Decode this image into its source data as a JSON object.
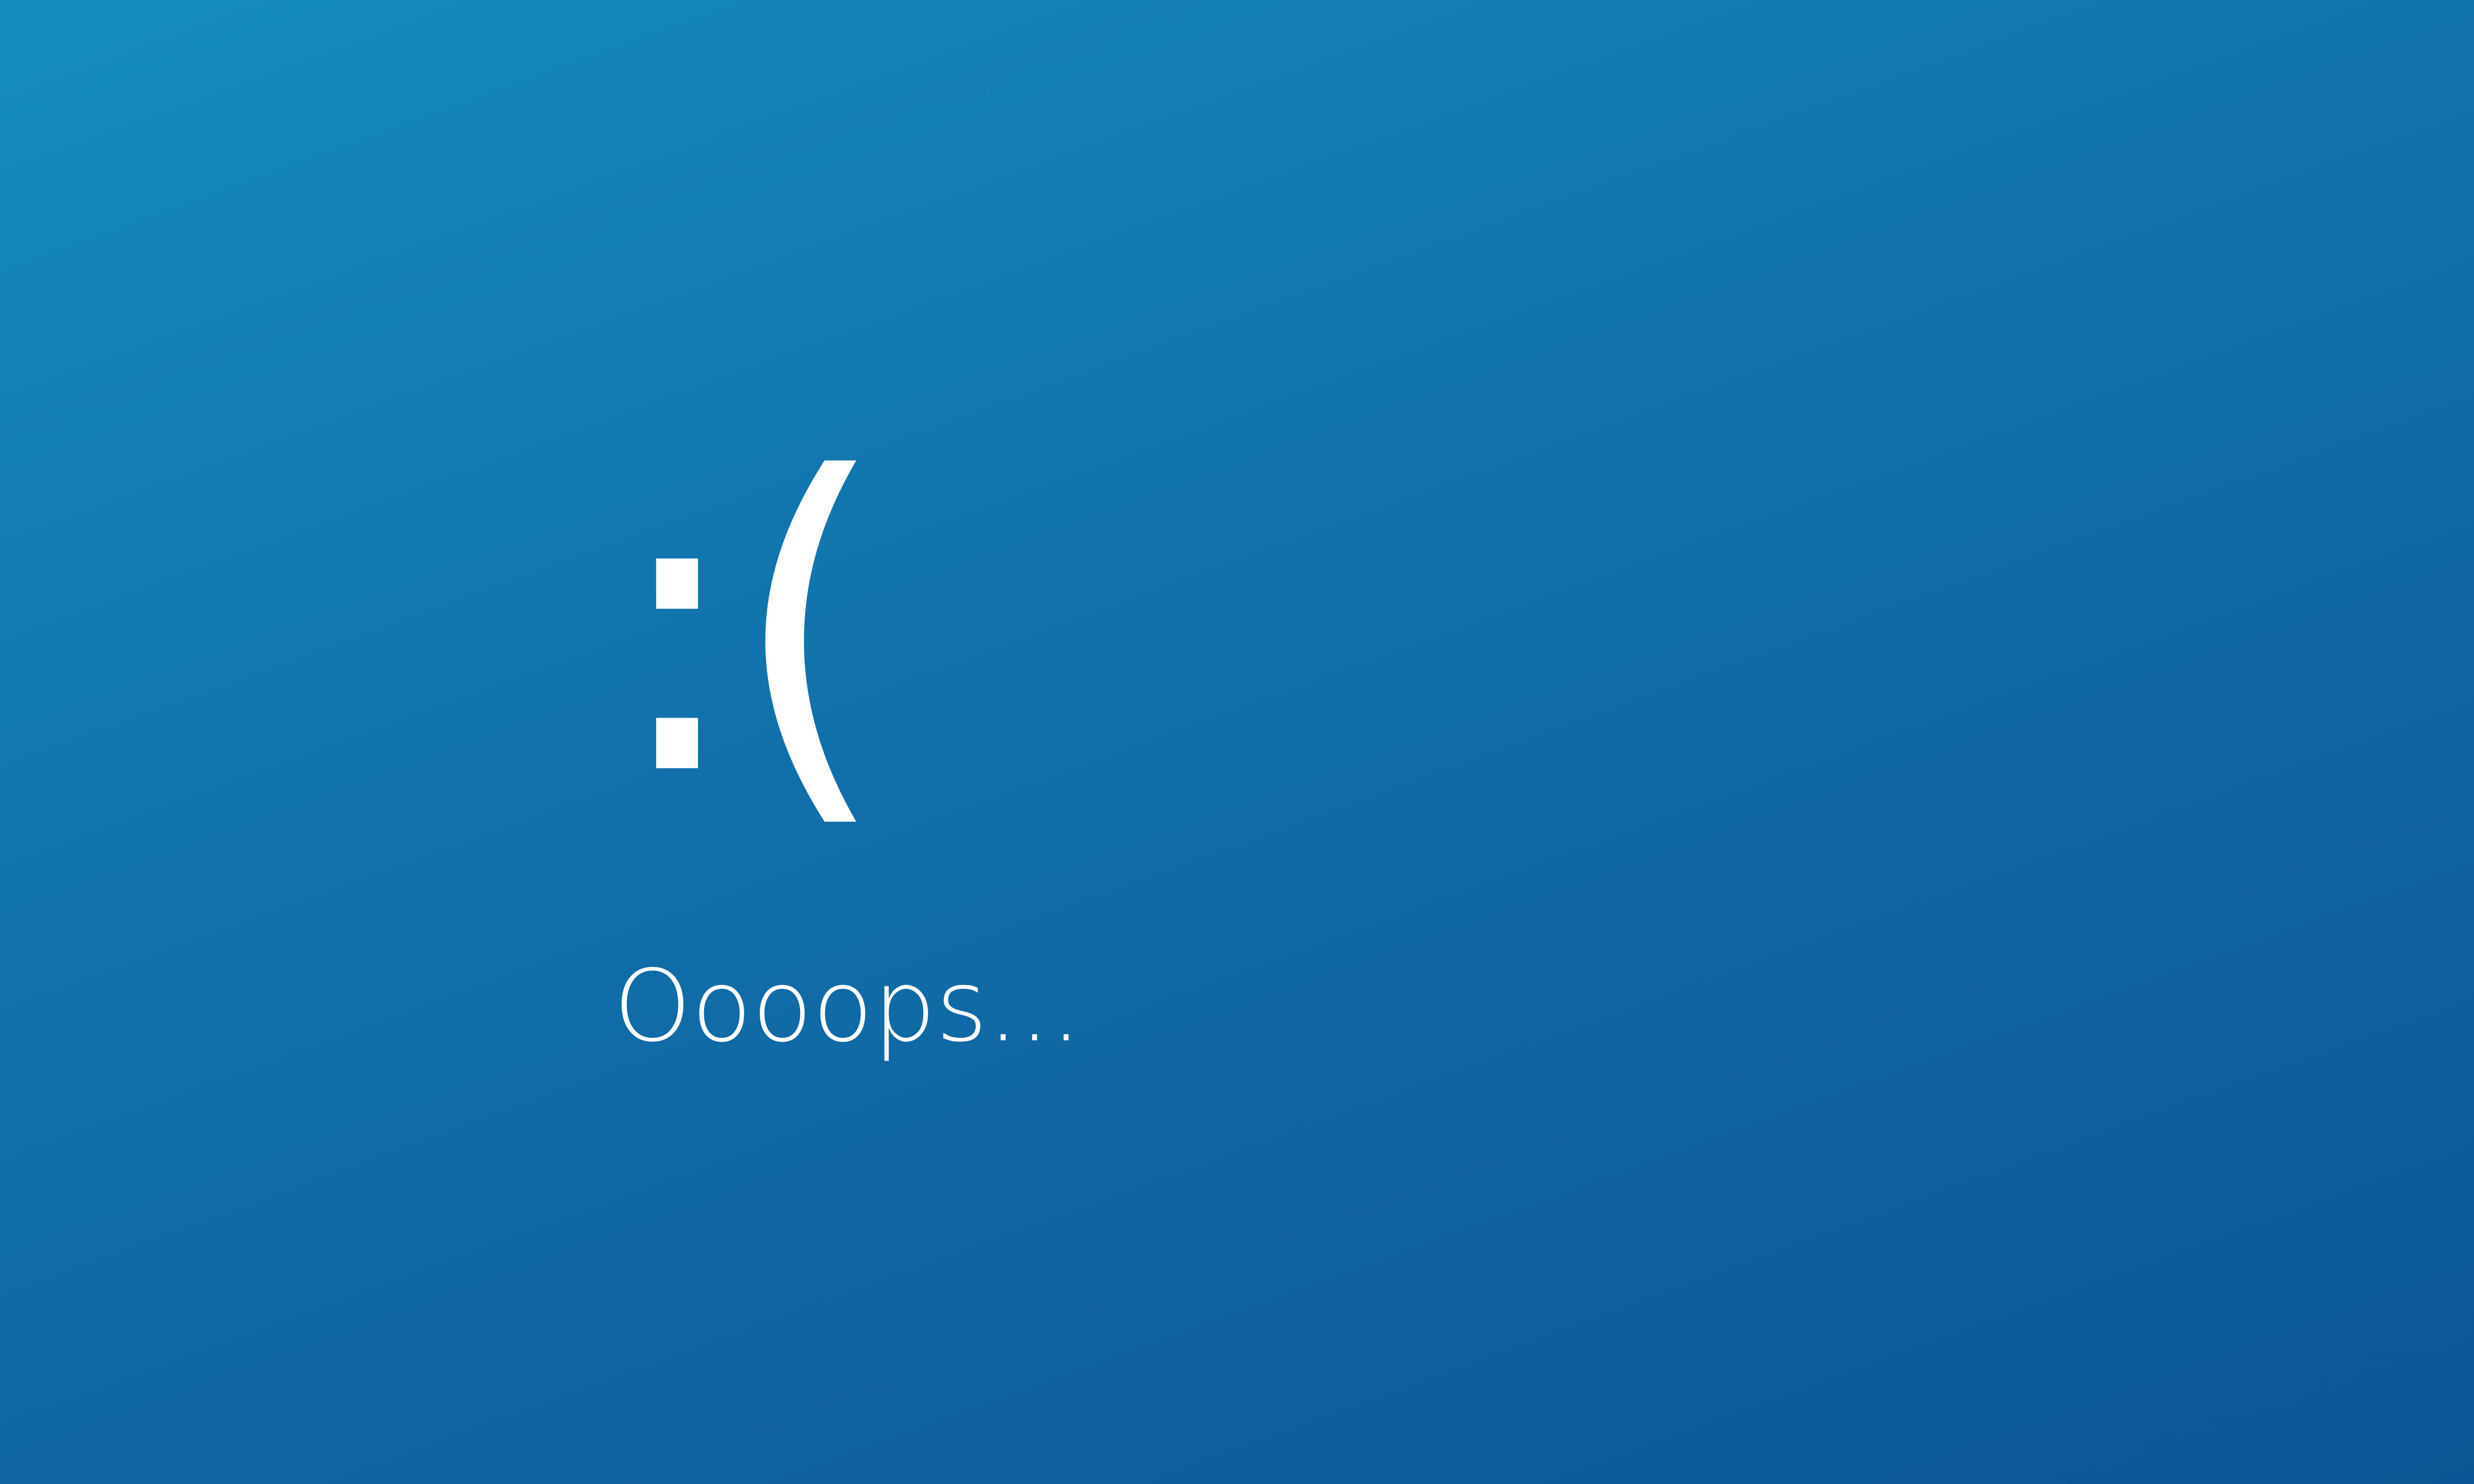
{
  "screen": {
    "background_top_left": "#158cbd",
    "background_bottom_right": "#0c5594",
    "text_color": "#ffffff",
    "emoticon": ":(",
    "message": "Oooops..."
  }
}
